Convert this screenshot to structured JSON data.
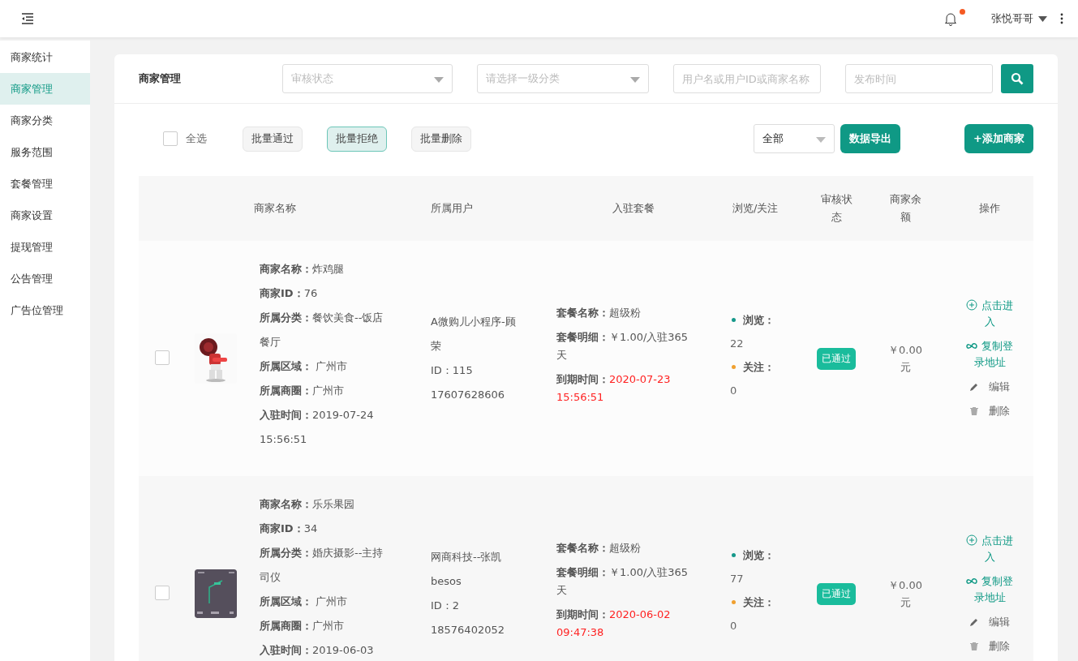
{
  "header": {
    "notifications": {
      "unread": true
    },
    "user": {
      "name": "张悦哥哥"
    }
  },
  "sidebar": {
    "items": [
      {
        "label": "商家统计",
        "selected": false
      },
      {
        "label": "商家管理",
        "selected": true
      },
      {
        "label": "商家分类",
        "selected": false
      },
      {
        "label": "服务范围",
        "selected": false
      },
      {
        "label": "套餐管理",
        "selected": false
      },
      {
        "label": "商家设置",
        "selected": false
      },
      {
        "label": "提现管理",
        "selected": false
      },
      {
        "label": "公告管理",
        "selected": false
      },
      {
        "label": "广告位管理",
        "selected": false
      }
    ]
  },
  "filters": {
    "title": "商家管理",
    "fields": [
      {
        "kind": "select",
        "placeholder": "审核状态"
      },
      {
        "kind": "select",
        "placeholder": "请选择一级分类"
      },
      {
        "kind": "input",
        "placeholder": "用户名或用户ID或商家名称"
      },
      {
        "kind": "input",
        "placeholder": "发布时间"
      }
    ]
  },
  "toolbar": {
    "select_all": {
      "label": "全选",
      "checked": false
    },
    "batch_buttons": [
      {
        "label": "批量通过",
        "selected": false
      },
      {
        "label": "批量拒绝",
        "selected": true
      },
      {
        "label": "批量删除",
        "selected": false
      }
    ],
    "scope_select": {
      "value": "全部"
    },
    "export_button": "数据导出",
    "add_button": "+添加商家"
  },
  "table": {
    "columns": [
      "商家名称",
      "所属用户",
      "入驻套餐",
      "浏览/关注",
      "审核状态",
      "商家余额",
      "操作"
    ],
    "rows": [
      {
        "checked": false,
        "picture": {
          "kind": "picture"
        },
        "info": [
          {
            "label": "商家名称：",
            "value": "炸鸡腿"
          },
          {
            "label": "商家ID：",
            "value": "76"
          },
          {
            "label": "所属分类：",
            "value": "餐饮美食--饭店餐厅"
          },
          {
            "label": "所属区域：",
            "value": " 广州市"
          },
          {
            "label": "所属商圈：",
            "value": "广州市"
          },
          {
            "label": "入驻时间：",
            "value": "2019-07-24 15:56:51"
          }
        ],
        "user": [
          "A微购儿小程序-顾荣",
          "ID：115",
          "17607628606"
        ],
        "package": [
          {
            "label": "套餐名称：",
            "value": "超级粉",
            "kind": "plain"
          },
          {
            "label": "套餐明细：",
            "value": "￥1.00/入驻365天",
            "kind": "plain"
          },
          {
            "label": "到期时间：",
            "value": "2020-07-23 15:56:51",
            "kind": "deadline"
          }
        ],
        "stats": [
          {
            "label": "浏览：",
            "value": "22",
            "color": "#16988a"
          },
          {
            "label": "关注：",
            "value": "0",
            "color": "#f0a030"
          }
        ],
        "status": {
          "label": "已通过",
          "kind": "approved"
        },
        "balance": "￥0.00元",
        "actions": [
          {
            "label": "点击进入",
            "kind": "enter"
          },
          {
            "label": "复制登录地址",
            "kind": "copy"
          },
          {
            "label": "编辑",
            "kind": "edit"
          },
          {
            "label": "删除",
            "kind": "delete"
          }
        ]
      },
      {
        "checked": false,
        "picture": {
          "kind": "picture"
        },
        "info": [
          {
            "label": "商家名称：",
            "value": "乐乐果园"
          },
          {
            "label": "商家ID：",
            "value": "34"
          },
          {
            "label": "所属分类：",
            "value": "婚庆摄影--主持司仪"
          },
          {
            "label": "所属区域：",
            "value": " 广州市"
          },
          {
            "label": "所属商圈：",
            "value": "广州市"
          },
          {
            "label": "入驻时间：",
            "value": "2019-06-03"
          }
        ],
        "user": [
          "网商科技--张凯besos",
          "ID：2",
          "18576402052"
        ],
        "package": [
          {
            "label": "套餐名称：",
            "value": "超级粉",
            "kind": "plain"
          },
          {
            "label": "套餐明细：",
            "value": "￥1.00/入驻365天",
            "kind": "plain"
          },
          {
            "label": "到期时间：",
            "value": "2020-06-02 09:47:38",
            "kind": "deadline"
          }
        ],
        "stats": [
          {
            "label": "浏览：",
            "value": "77",
            "color": "#16988a"
          },
          {
            "label": "关注：",
            "value": "0",
            "color": "#f0a030"
          }
        ],
        "status": {
          "label": "已通过",
          "kind": "approved"
        },
        "balance": "￥0.00元",
        "actions": [
          {
            "label": "点击进入",
            "kind": "enter"
          },
          {
            "label": "复制登录地址",
            "kind": "copy"
          },
          {
            "label": "编辑",
            "kind": "edit"
          },
          {
            "label": "删除",
            "kind": "delete"
          }
        ]
      }
    ]
  }
}
